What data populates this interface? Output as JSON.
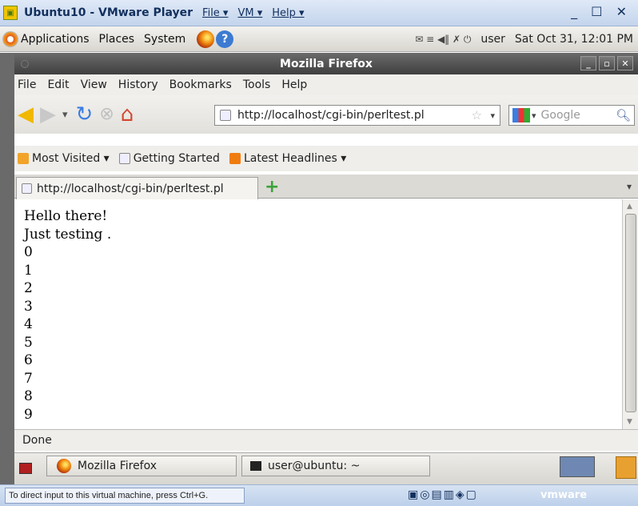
{
  "vmware": {
    "title": "Ubuntu10 - VMware Player",
    "menus": [
      "File ▾",
      "VM ▾",
      "Help ▾"
    ],
    "controls": "_ ☐ ✕",
    "status_hint": "To direct input to this virtual machine, press Ctrl+G.",
    "devices": "▣◎▤▥◈▢",
    "brand": "vmware"
  },
  "gnome_panel": {
    "menus": [
      "Applications",
      "Places",
      "System"
    ],
    "user": "user",
    "clock": "Sat Oct 31, 12:01 PM",
    "tray": "✉ ≡ ◀‖ ✗ ⏻"
  },
  "firefox": {
    "window_title": "Mozilla Firefox",
    "menubar": [
      "File",
      "Edit",
      "View",
      "History",
      "Bookmarks",
      "Tools",
      "Help"
    ],
    "url": "http://localhost/cgi-bin/perltest.pl",
    "search_placeholder": "Google",
    "bookmarks": [
      "Most Visited ▾",
      "Getting Started",
      "Latest Headlines ▾"
    ],
    "tab_title": "http://localhost/cgi-bin/perltest.pl",
    "page_lines": [
      "Hello there!",
      "Just testing .",
      "0",
      "1",
      "2",
      "3",
      "4",
      "5",
      "6",
      "7",
      "8",
      "9"
    ],
    "status": "Done"
  },
  "taskbar": {
    "items": [
      "Mozilla Firefox",
      "user@ubuntu: ~"
    ]
  }
}
